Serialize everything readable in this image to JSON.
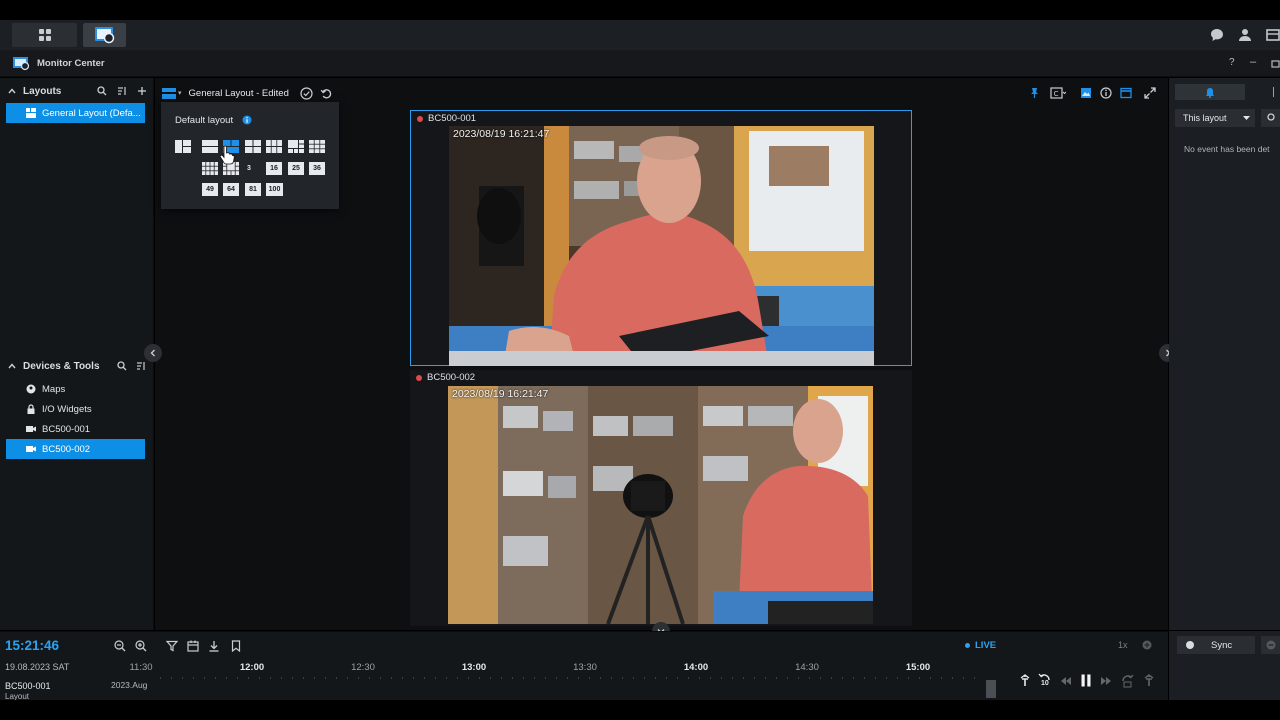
{
  "app": {
    "title": "Monitor Center",
    "help": "?",
    "minimize": "–"
  },
  "sidebar": {
    "layouts_header": "Layouts",
    "layouts": [
      {
        "label": "General Layout (Defa..."
      }
    ],
    "devices_header": "Devices & Tools",
    "devices": [
      {
        "label": "Maps",
        "icon": "map-pin-icon"
      },
      {
        "label": "I/O Widgets",
        "icon": "lock-icon"
      },
      {
        "label": "BC500-001",
        "icon": "camera-icon"
      },
      {
        "label": "BC500-002",
        "icon": "camera-icon"
      }
    ]
  },
  "layout_bar": {
    "title": "General Layout - Edited"
  },
  "layout_popover": {
    "title": "Default layout",
    "row2_labels": [
      "3",
      "16",
      "25",
      "36"
    ],
    "row3_labels": [
      "49",
      "64",
      "81",
      "100"
    ]
  },
  "cameras": [
    {
      "name": "BC500-001",
      "timestamp": "2023/08/19 16:21:47"
    },
    {
      "name": "BC500-002",
      "timestamp": "2023/08/19 16:21:47"
    }
  ],
  "right_panel": {
    "filter": "This layout",
    "empty_text": "No event has been det"
  },
  "timeline": {
    "clock": "15:21:46",
    "date": "19.08.2023 SAT",
    "live": "LIVE",
    "ticks": [
      "11:30",
      "12:00",
      "12:30",
      "13:00",
      "13:30",
      "14:00",
      "14:30",
      "15:00"
    ],
    "track_label": "BC500-001",
    "track_sub": "Layout",
    "track_date": "2023.Aug"
  },
  "controls": {
    "sync": "Sync",
    "speed": "1x",
    "skip": "10"
  },
  "colors": {
    "accent": "#0e8fe6",
    "live": "#2aa3f2",
    "record": "#e04a4a"
  }
}
